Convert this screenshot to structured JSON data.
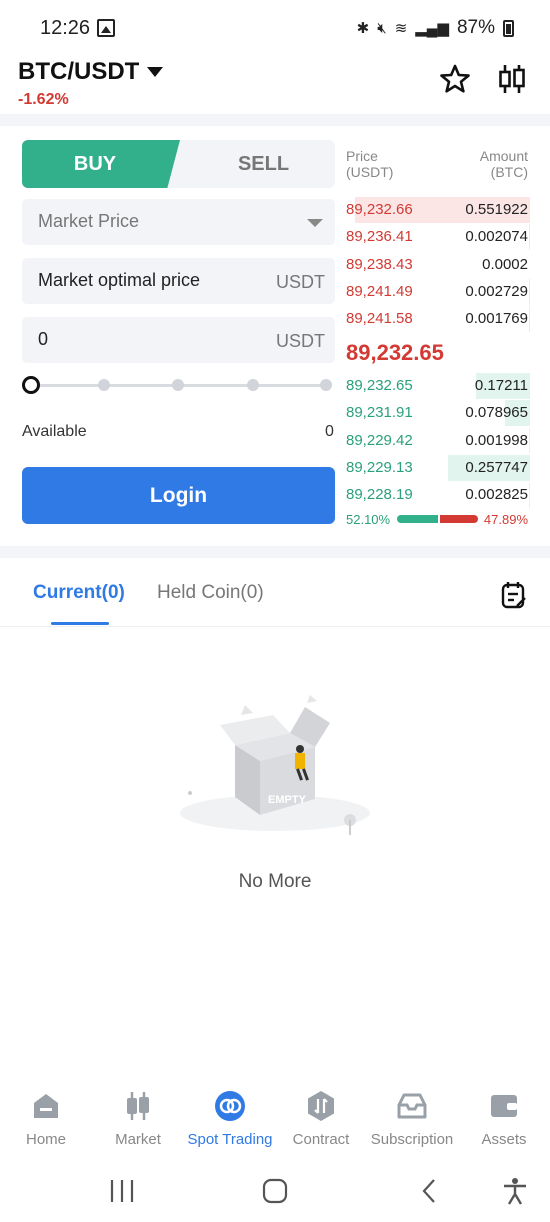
{
  "status_bar": {
    "time": "12:26",
    "battery": "87%"
  },
  "header": {
    "pair": "BTC/USDT",
    "change": "-1.62%",
    "change_color": "#d23a33"
  },
  "trade_form": {
    "buy_label": "BUY",
    "sell_label": "SELL",
    "order_type": "Market Price",
    "price_field": {
      "value": "Market optimal price",
      "unit": "USDT"
    },
    "amount_field": {
      "value": "0",
      "unit": "USDT"
    },
    "available_label": "Available",
    "available_value": "0",
    "login_label": "Login",
    "slider_value": 0
  },
  "order_book": {
    "price_header": "Price\n(USDT)",
    "price_header_l1": "Price",
    "price_header_l2": "(USDT)",
    "amount_header_l1": "Amount",
    "amount_header_l2": "(BTC)",
    "asks": [
      {
        "price": "89,232.66",
        "amount": "0.551922"
      },
      {
        "price": "89,236.41",
        "amount": "0.002074"
      },
      {
        "price": "89,238.43",
        "amount": "0.0002"
      },
      {
        "price": "89,241.49",
        "amount": "0.002729"
      },
      {
        "price": "89,241.58",
        "amount": "0.001769"
      }
    ],
    "last_price": "89,232.65",
    "bids": [
      {
        "price": "89,232.65",
        "amount": "0.17211"
      },
      {
        "price": "89,231.91",
        "amount": "0.078965"
      },
      {
        "price": "89,229.42",
        "amount": "0.001998"
      },
      {
        "price": "89,229.13",
        "amount": "0.257747"
      },
      {
        "price": "89,228.19",
        "amount": "0.002825"
      }
    ],
    "buy_ratio": "52.10%",
    "sell_ratio": "47.89%",
    "buy_ratio_value": 52.1,
    "ask_color": "#d23a33",
    "bid_color": "#2aa07c"
  },
  "orders": {
    "tab_current": "Current(0)",
    "tab_held": "Held Coin(0)",
    "empty_badge": "EMPTY",
    "empty_text": "No More"
  },
  "bottom_nav": [
    {
      "label": "Home",
      "icon": "home-icon"
    },
    {
      "label": "Market",
      "icon": "market-icon"
    },
    {
      "label": "Spot Trading",
      "icon": "spot-trading-icon",
      "active": true
    },
    {
      "label": "Contract",
      "icon": "contract-icon"
    },
    {
      "label": "Subscription",
      "icon": "subscription-icon"
    },
    {
      "label": "Assets",
      "icon": "assets-icon"
    }
  ],
  "colors": {
    "accent": "#2f7ae5",
    "buy": "#32b08c",
    "sell": "#d23a33"
  }
}
